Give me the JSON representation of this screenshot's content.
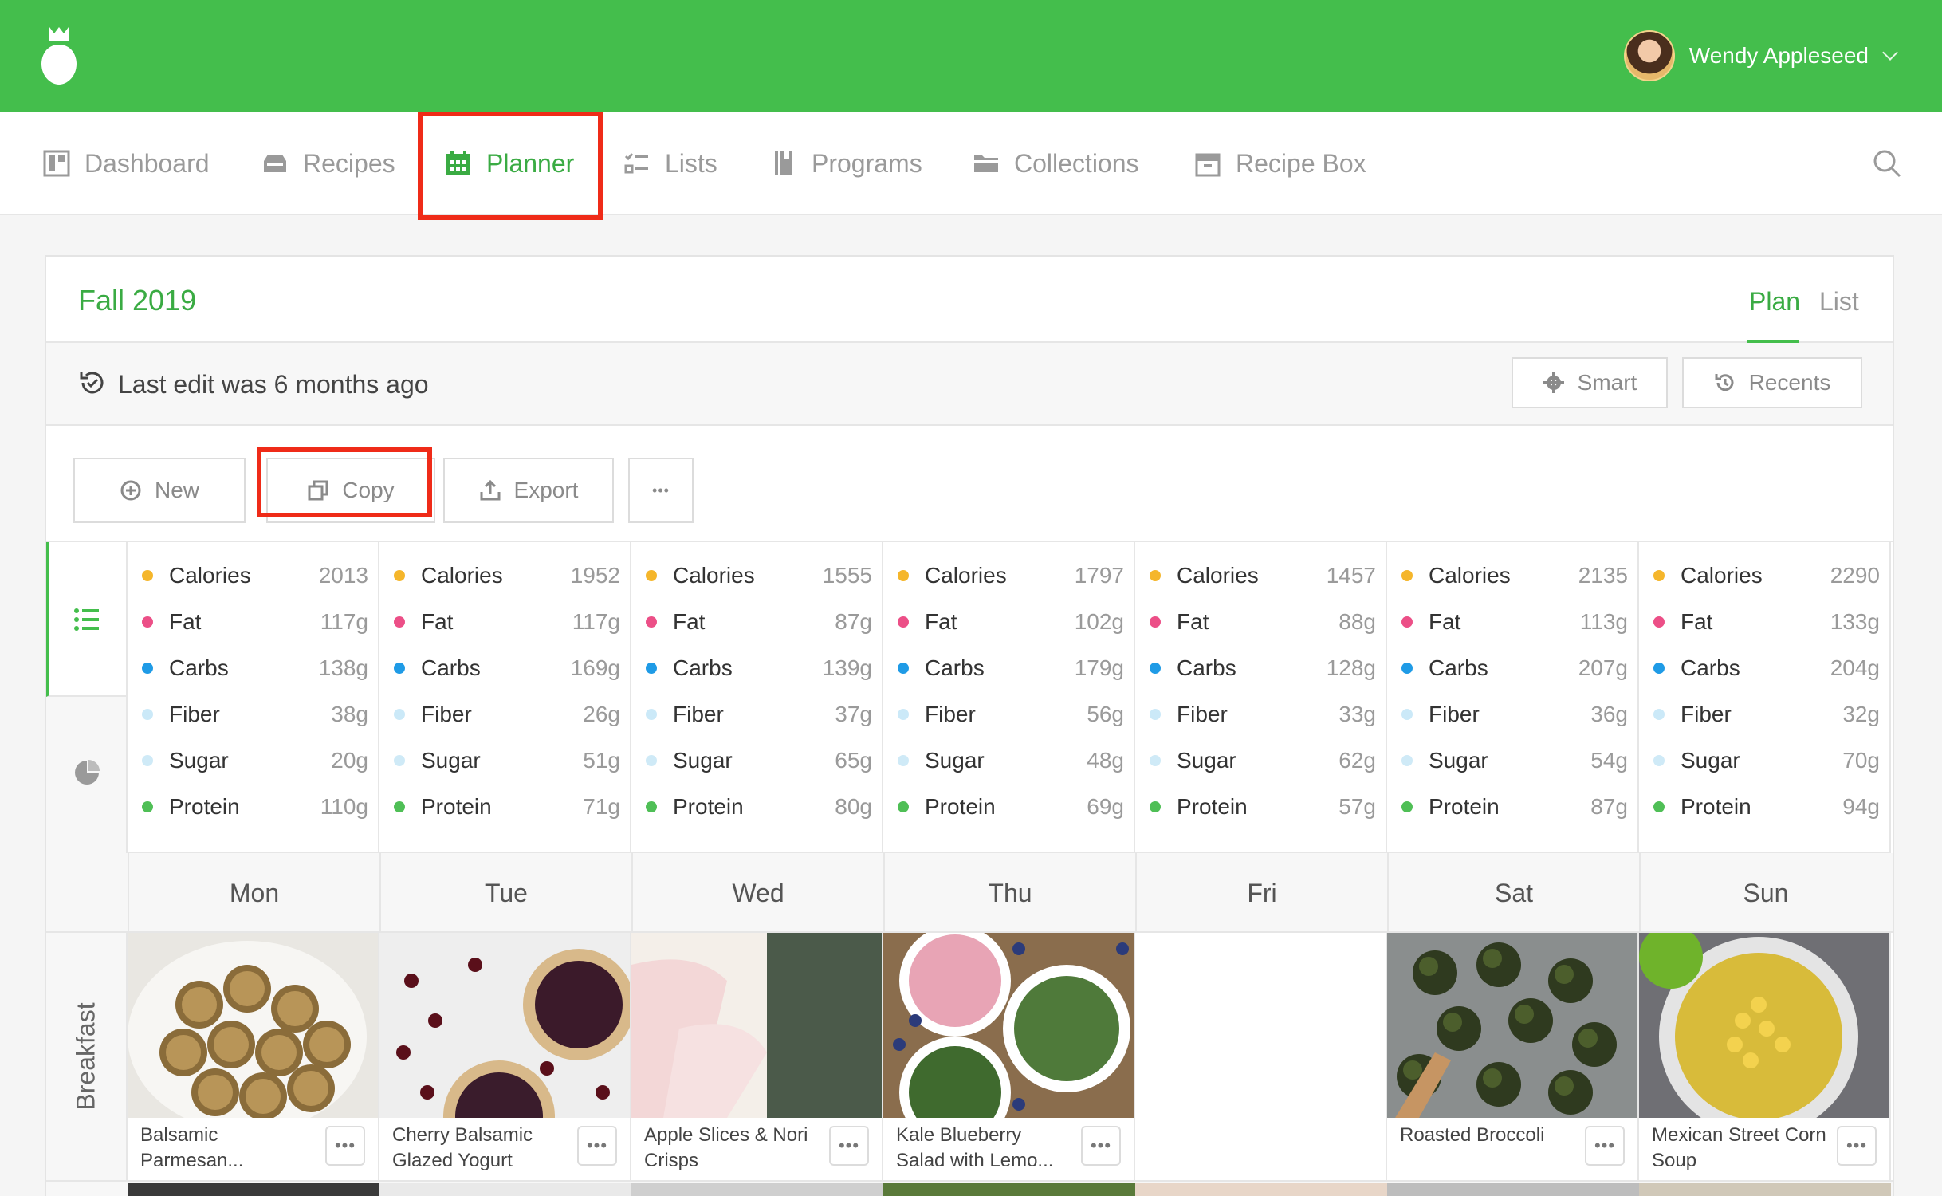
{
  "user": {
    "name": "Wendy Appleseed"
  },
  "nav": {
    "items": [
      {
        "label": "Dashboard",
        "icon": "dashboard-icon"
      },
      {
        "label": "Recipes",
        "icon": "recipes-icon"
      },
      {
        "label": "Planner",
        "icon": "calendar-icon",
        "active": true
      },
      {
        "label": "Lists",
        "icon": "checklist-icon"
      },
      {
        "label": "Programs",
        "icon": "book-icon"
      },
      {
        "label": "Collections",
        "icon": "folder-icon"
      },
      {
        "label": "Recipe Box",
        "icon": "box-icon"
      }
    ]
  },
  "planner": {
    "title": "Fall 2019",
    "tabs": [
      "Plan",
      "List"
    ],
    "last_edit": "Last edit was 6 months ago",
    "smart_label": "Smart",
    "recents_label": "Recents",
    "actions": {
      "new": "New",
      "copy": "Copy",
      "export": "Export",
      "more": "•••"
    }
  },
  "nutrition_labels": [
    "Calories",
    "Fat",
    "Carbs",
    "Fiber",
    "Sugar",
    "Protein"
  ],
  "nutrition_colors": [
    "#f5b62b",
    "#ec4f87",
    "#1f9be6",
    "#cbe9f8",
    "#cfeaf7",
    "#4fbf56"
  ],
  "days": [
    {
      "name": "Mon",
      "values": [
        "2013",
        "117g",
        "138g",
        "38g",
        "20g",
        "110g"
      ]
    },
    {
      "name": "Tue",
      "values": [
        "1952",
        "117g",
        "169g",
        "26g",
        "51g",
        "71g"
      ]
    },
    {
      "name": "Wed",
      "values": [
        "1555",
        "87g",
        "139g",
        "37g",
        "65g",
        "80g"
      ]
    },
    {
      "name": "Thu",
      "values": [
        "1797",
        "102g",
        "179g",
        "56g",
        "48g",
        "69g"
      ]
    },
    {
      "name": "Fri",
      "values": [
        "1457",
        "88g",
        "128g",
        "33g",
        "62g",
        "57g"
      ]
    },
    {
      "name": "Sat",
      "values": [
        "2135",
        "113g",
        "207g",
        "36g",
        "54g",
        "87g"
      ]
    },
    {
      "name": "Sun",
      "values": [
        "2290",
        "133g",
        "204g",
        "32g",
        "70g",
        "94g"
      ]
    }
  ],
  "meal": {
    "label": "Breakfast",
    "recipes": [
      {
        "day": "Mon",
        "name": "Balsamic Parmesan..."
      },
      {
        "day": "Tue",
        "name": "Cherry Balsamic Glazed Yogurt"
      },
      {
        "day": "Wed",
        "name": "Apple Slices & Nori Crisps"
      },
      {
        "day": "Thu",
        "name": "Kale Blueberry Salad with Lemo..."
      },
      {
        "day": "Fri",
        "name": ""
      },
      {
        "day": "Sat",
        "name": "Roasted Broccoli"
      },
      {
        "day": "Sun",
        "name": "Mexican Street Corn Soup"
      }
    ]
  }
}
